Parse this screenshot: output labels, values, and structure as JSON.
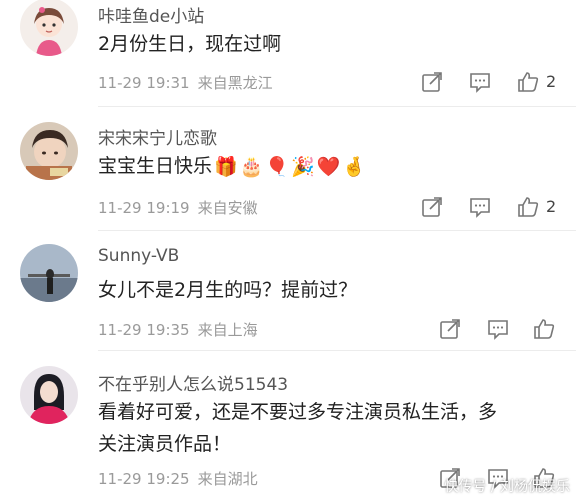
{
  "comments": [
    {
      "username": "咔哇鱼de小站",
      "text": "2月份生日，现在过啊",
      "time": "11-29 19:31",
      "source": "来自黑龙江",
      "like_count": "2"
    },
    {
      "username": "宋宋宋宁儿恋歌",
      "text": "宝宝生日快乐",
      "emojis": [
        "🎁",
        "🎂",
        "🎈",
        "🎉",
        "❤️",
        "🤞"
      ],
      "time": "11-29 19:19",
      "source": "来自安徽",
      "like_count": "2"
    },
    {
      "username": "Sunny-VB",
      "text": "女儿不是2月生的吗？提前过？",
      "time": "11-29 19:35",
      "source": "来自上海",
      "like_count": ""
    },
    {
      "username": "不在乎别人怎么说51543",
      "text_line1": "看着好可爱，还是不要过多专注演员私生活，多",
      "text_line2": "关注演员作品！",
      "time": "11-29 19:25",
      "source": "来自湖北",
      "like_count": ""
    }
  ],
  "watermark": "快传号 / 刘杨侃娱乐",
  "icons": [
    "share-icon",
    "comment-icon",
    "like-icon"
  ],
  "colors": {
    "text": "#222222",
    "meta": "#9a9a9a",
    "username": "#555555"
  }
}
